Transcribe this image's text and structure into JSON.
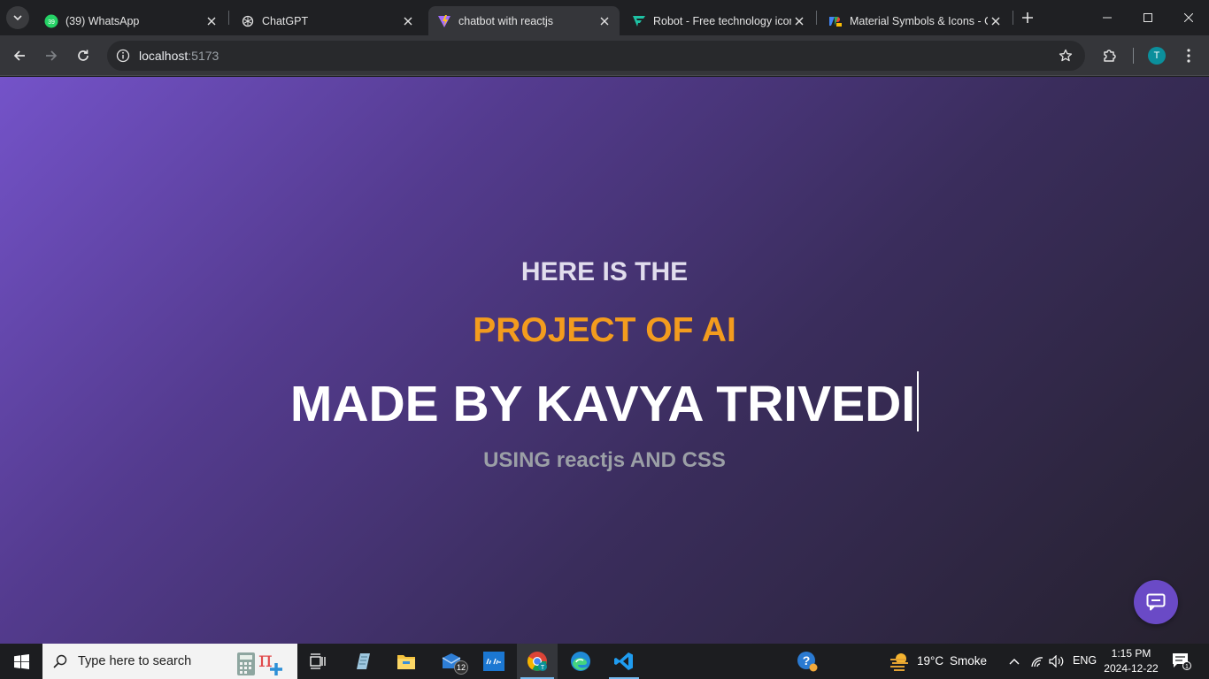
{
  "browser": {
    "tabs": [
      {
        "title": "(39) WhatsApp",
        "favicon": "whatsapp-icon",
        "badge": "39"
      },
      {
        "title": "ChatGPT",
        "favicon": "chatgpt-icon"
      },
      {
        "title": "chatbot with reactjs",
        "favicon": "vite-icon",
        "active": true
      },
      {
        "title": "Robot - Free technology icon",
        "favicon": "flaticon-icon"
      },
      {
        "title": "Material Symbols & Icons - G",
        "favicon": "google-fonts-icon"
      }
    ],
    "address": {
      "host": "localhost",
      "port": ":5173"
    },
    "profile_initial": "T"
  },
  "page": {
    "line1": "HERE IS THE",
    "line2": "PROJECT OF AI",
    "line3": "MADE BY KAVYA TRIVEDI",
    "line4": "USING reactjs AND CSS",
    "colors": {
      "accent": "#f39c1e",
      "fab": "#6a4ac6",
      "gradient_start": "#7453c9",
      "gradient_end": "#25212d"
    }
  },
  "taskbar": {
    "search_placeholder": "Type here to search",
    "mail_badge": "12",
    "weather": {
      "temp": "19°C",
      "condition": "Smoke"
    },
    "language": "ENG",
    "time": "1:15 PM",
    "date": "2024-12-22",
    "notification_count": "1"
  }
}
